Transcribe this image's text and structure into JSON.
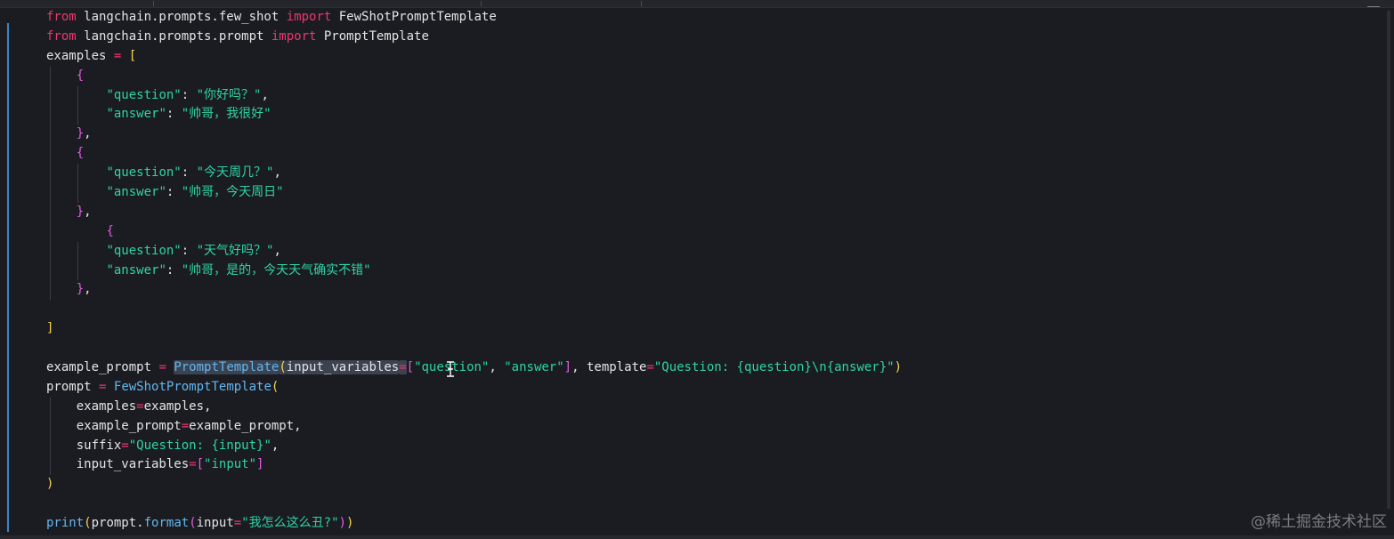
{
  "editor": {
    "code_lines": [
      [
        {
          "t": "from",
          "c": "kw"
        },
        {
          "t": " langchain.prompts.few_shot ",
          "c": "id"
        },
        {
          "t": "import",
          "c": "kw"
        },
        {
          "t": " FewShotPromptTemplate",
          "c": "id"
        }
      ],
      [
        {
          "t": "from",
          "c": "kw"
        },
        {
          "t": " langchain.prompts.prompt ",
          "c": "id"
        },
        {
          "t": "import",
          "c": "kw"
        },
        {
          "t": " PromptTemplate",
          "c": "id"
        }
      ],
      [
        {
          "t": "examples ",
          "c": "id"
        },
        {
          "t": "=",
          "c": "op"
        },
        {
          "t": " ",
          "c": "id"
        },
        {
          "t": "[",
          "c": "br-y"
        }
      ],
      [
        {
          "t": "    ",
          "c": "id"
        },
        {
          "t": "{",
          "c": "br-p"
        }
      ],
      [
        {
          "t": "        ",
          "c": "id"
        },
        {
          "t": "\"question\"",
          "c": "str"
        },
        {
          "t": ": ",
          "c": "txt"
        },
        {
          "t": "\"你好吗？\"",
          "c": "str"
        },
        {
          "t": ",",
          "c": "txt"
        }
      ],
      [
        {
          "t": "        ",
          "c": "id"
        },
        {
          "t": "\"answer\"",
          "c": "str"
        },
        {
          "t": ": ",
          "c": "txt"
        },
        {
          "t": "\"帅哥，我很好\"",
          "c": "str"
        }
      ],
      [
        {
          "t": "    ",
          "c": "id"
        },
        {
          "t": "}",
          "c": "br-p"
        },
        {
          "t": ",",
          "c": "txt"
        }
      ],
      [
        {
          "t": "    ",
          "c": "id"
        },
        {
          "t": "{",
          "c": "br-p"
        }
      ],
      [
        {
          "t": "        ",
          "c": "id"
        },
        {
          "t": "\"question\"",
          "c": "str"
        },
        {
          "t": ": ",
          "c": "txt"
        },
        {
          "t": "\"今天周几？\"",
          "c": "str"
        },
        {
          "t": ",",
          "c": "txt"
        }
      ],
      [
        {
          "t": "        ",
          "c": "id"
        },
        {
          "t": "\"answer\"",
          "c": "str"
        },
        {
          "t": ": ",
          "c": "txt"
        },
        {
          "t": "\"帅哥，今天周日\"",
          "c": "str"
        }
      ],
      [
        {
          "t": "    ",
          "c": "id"
        },
        {
          "t": "}",
          "c": "br-p"
        },
        {
          "t": ",",
          "c": "txt"
        }
      ],
      [
        {
          "t": "        ",
          "c": "id"
        },
        {
          "t": "{",
          "c": "br-p"
        }
      ],
      [
        {
          "t": "        ",
          "c": "id"
        },
        {
          "t": "\"question\"",
          "c": "str"
        },
        {
          "t": ": ",
          "c": "txt"
        },
        {
          "t": "\"天气好吗？\"",
          "c": "str"
        },
        {
          "t": ",",
          "c": "txt"
        }
      ],
      [
        {
          "t": "        ",
          "c": "id"
        },
        {
          "t": "\"answer\"",
          "c": "str"
        },
        {
          "t": ": ",
          "c": "txt"
        },
        {
          "t": "\"帅哥，是的，今天天气确实不错\"",
          "c": "str"
        }
      ],
      [
        {
          "t": "    ",
          "c": "id"
        },
        {
          "t": "}",
          "c": "br-p"
        },
        {
          "t": ",",
          "c": "txt"
        }
      ],
      [],
      [
        {
          "t": "]",
          "c": "br-y"
        }
      ],
      [],
      [
        {
          "t": "example_prompt ",
          "c": "id"
        },
        {
          "t": "=",
          "c": "op"
        },
        {
          "t": " ",
          "c": "id"
        },
        {
          "t": "PromptTemplate",
          "c": "fn hl"
        },
        {
          "t": "(",
          "c": "br-y hl"
        },
        {
          "t": "input_variables",
          "c": "id hl"
        },
        {
          "t": "=",
          "c": "op hl"
        },
        {
          "t": "[",
          "c": "br-p"
        },
        {
          "t": "\"question\"",
          "c": "str"
        },
        {
          "t": ", ",
          "c": "txt"
        },
        {
          "t": "\"answer\"",
          "c": "str"
        },
        {
          "t": "]",
          "c": "br-p"
        },
        {
          "t": ", template",
          "c": "id"
        },
        {
          "t": "=",
          "c": "op"
        },
        {
          "t": "\"Question: {question}\\n{answer}\"",
          "c": "str"
        },
        {
          "t": ")",
          "c": "br-y"
        }
      ],
      [
        {
          "t": "prompt ",
          "c": "id"
        },
        {
          "t": "=",
          "c": "op"
        },
        {
          "t": " ",
          "c": "id"
        },
        {
          "t": "FewShotPromptTemplate",
          "c": "fn"
        },
        {
          "t": "(",
          "c": "br-y"
        }
      ],
      [
        {
          "t": "    examples",
          "c": "id"
        },
        {
          "t": "=",
          "c": "op"
        },
        {
          "t": "examples,",
          "c": "id"
        }
      ],
      [
        {
          "t": "    example_prompt",
          "c": "id"
        },
        {
          "t": "=",
          "c": "op"
        },
        {
          "t": "example_prompt,",
          "c": "id"
        }
      ],
      [
        {
          "t": "    suffix",
          "c": "id"
        },
        {
          "t": "=",
          "c": "op"
        },
        {
          "t": "\"Question: {input}\"",
          "c": "str"
        },
        {
          "t": ",",
          "c": "txt"
        }
      ],
      [
        {
          "t": "    input_variables",
          "c": "id"
        },
        {
          "t": "=",
          "c": "op"
        },
        {
          "t": "[",
          "c": "br-p"
        },
        {
          "t": "\"input\"",
          "c": "str"
        },
        {
          "t": "]",
          "c": "br-p"
        }
      ],
      [
        {
          "t": ")",
          "c": "br-y"
        }
      ],
      [],
      [
        {
          "t": "print",
          "c": "fn"
        },
        {
          "t": "(",
          "c": "br-y"
        },
        {
          "t": "prompt.",
          "c": "id"
        },
        {
          "t": "format",
          "c": "fn"
        },
        {
          "t": "(",
          "c": "br-p"
        },
        {
          "t": "input",
          "c": "id"
        },
        {
          "t": "=",
          "c": "op"
        },
        {
          "t": "\"我怎么这么丑?\"",
          "c": "str"
        },
        {
          "t": ")",
          "c": "br-p"
        },
        {
          "t": ")",
          "c": "br-y"
        }
      ]
    ]
  },
  "watermark": {
    "text": "@稀土掘金技术社区"
  },
  "colors": {
    "background": "#1b1c21",
    "keyword": "#f0356c",
    "string": "#2ed3a6",
    "function": "#62b6f0",
    "bracket_yellow": "#f7d54f",
    "bracket_purple": "#e25ce2",
    "gutter_accent": "#3a86c8"
  },
  "icons": {
    "text_cursor": "i-beam-cursor-icon",
    "top_right": "minimize-icon"
  }
}
